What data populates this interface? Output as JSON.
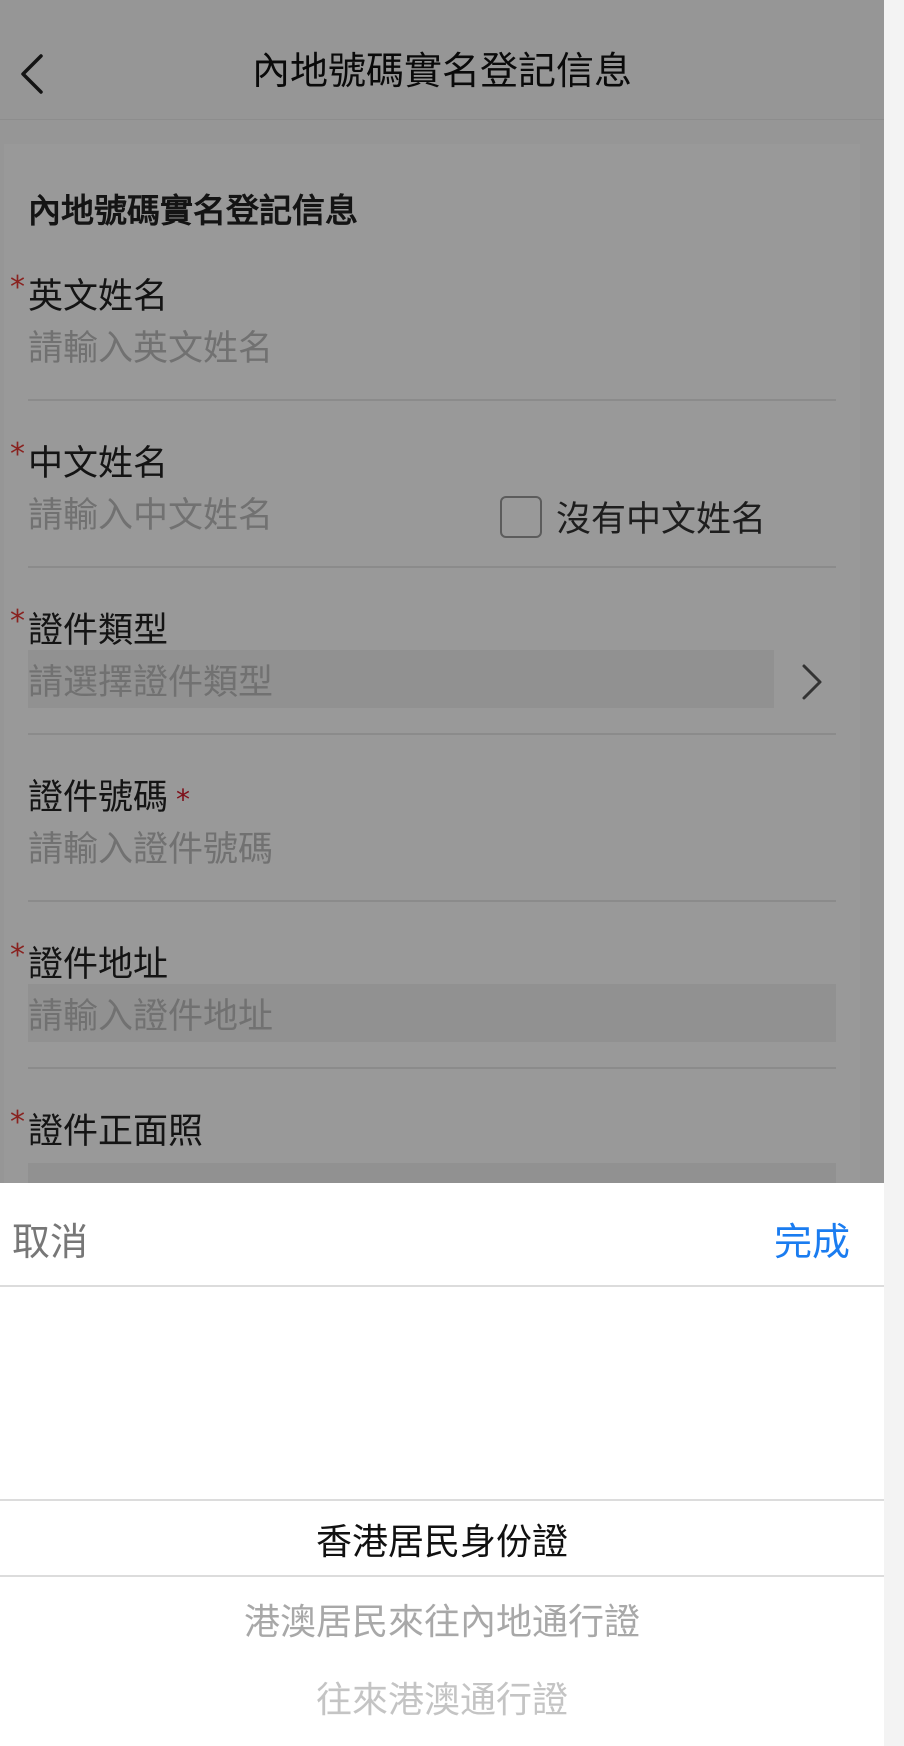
{
  "header": {
    "title": "內地號碼實名登記信息",
    "back_icon": "chevron-left-icon"
  },
  "form": {
    "section_title": "內地號碼實名登記信息",
    "required_mark": "*",
    "fields": [
      {
        "label": "英文姓名",
        "placeholder": "請輸入英文姓名"
      },
      {
        "label": "中文姓名",
        "placeholder": "請輸入中文姓名",
        "checkbox_label": "沒有中文姓名"
      },
      {
        "label": "證件類型",
        "placeholder": "請選擇證件類型"
      },
      {
        "label": "證件號碼",
        "placeholder": "請輸入證件號碼"
      },
      {
        "label": "證件地址",
        "placeholder": "請輸入證件地址"
      },
      {
        "label": "證件正面照"
      }
    ]
  },
  "picker": {
    "cancel_label": "取消",
    "done_label": "完成",
    "options": [
      "香港居民身份證",
      "港澳居民來往內地通行證",
      "往來港澳通行證"
    ],
    "selected": "香港居民身份證"
  },
  "colors": {
    "accent": "#1a7cf0",
    "required": "#e53935"
  }
}
